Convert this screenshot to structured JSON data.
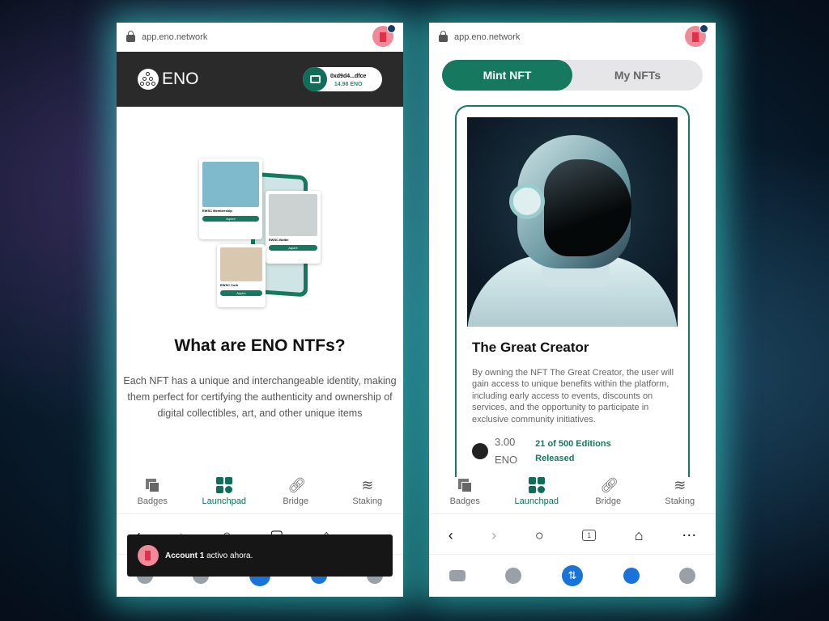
{
  "left": {
    "url": "app.eno.network",
    "logo": "ENO",
    "wallet": {
      "address": "0xd9d4...dfce",
      "balance": "14.98 ENO"
    },
    "illustration": {
      "cards": [
        "EWSC Membership",
        "EWSC Bottle",
        "EWSC Cork"
      ],
      "button": "Aquire"
    },
    "title": "What are ENO NTFs?",
    "paragraph": "Each NFT has a unique and interchangeable identity, making them perfect for certifying the authenticity and ownership of digital collectibles, art, and other unique items",
    "nav": [
      "Badges",
      "Launchpad",
      "Bridge",
      "Staking"
    ],
    "active_nav": "Launchpad",
    "toast": {
      "account": "Account 1",
      "message": "activo ahora."
    }
  },
  "right": {
    "url": "app.eno.network",
    "tabs": [
      "Mint NFT",
      "My NFTs"
    ],
    "active_tab": "Mint NFT",
    "nft": {
      "title": "The Great Creator",
      "description": "By owning the NFT The Great Creator, the user will gain access to unique benefits within the platform, including early access to events, discounts on services, and the opportunity to participate in exclusive community initiatives.",
      "price": "3.00",
      "currency": "ENO",
      "editions": "21 of 500 Editions Released"
    },
    "nav": [
      "Badges",
      "Launchpad",
      "Bridge",
      "Staking"
    ],
    "active_nav": "Launchpad",
    "toolbar": {
      "tab_count": "1"
    }
  },
  "colors": {
    "accent": "#15785f",
    "header": "#2b2a2b",
    "browser_blue": "#1a73d9"
  }
}
